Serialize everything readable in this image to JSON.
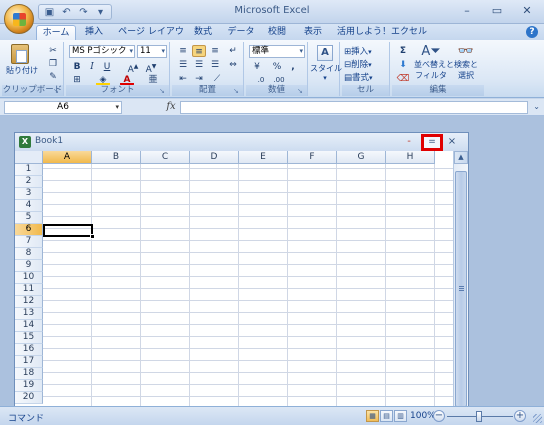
{
  "app": {
    "title": "Microsoft Excel",
    "quick_access": [
      "save-icon",
      "undo-icon",
      "redo-icon",
      "customize-icon"
    ],
    "window_controls": [
      "minimize",
      "restore",
      "close"
    ]
  },
  "ribbon": {
    "tabs": [
      {
        "label": "ホーム",
        "active": true
      },
      {
        "label": "挿入",
        "active": false
      },
      {
        "label": "ページ レイアウト",
        "active": false
      },
      {
        "label": "数式",
        "active": false
      },
      {
        "label": "データ",
        "active": false
      },
      {
        "label": "校閲",
        "active": false
      },
      {
        "label": "表示",
        "active": false
      },
      {
        "label": "活用しよう！エクセル",
        "active": false
      }
    ],
    "clipboard": {
      "group_label": "クリップボード",
      "paste_label": "貼り付け"
    },
    "font": {
      "group_label": "フォント",
      "font_name": "MS Pゴシック",
      "font_size": "11",
      "bold": "B",
      "italic": "I",
      "underline": "U"
    },
    "alignment": {
      "group_label": "配置"
    },
    "number": {
      "group_label": "数値",
      "format": "標準",
      "percent": "%",
      "comma": ","
    },
    "styles": {
      "label": "スタイル"
    },
    "cells": {
      "group_label": "セル",
      "insert": "挿入",
      "delete": "削除",
      "format": "書式"
    },
    "editing": {
      "group_label": "編集",
      "sum": "Σ",
      "sort_filter_1": "並べ替えと",
      "sort_filter_2": "フィルタ",
      "find_select_1": "検索と",
      "find_select_2": "選択"
    }
  },
  "formula_bar": {
    "name_box": "A6",
    "fx_label": "fx",
    "formula": ""
  },
  "workbook": {
    "name": "Book1",
    "columns": [
      "A",
      "B",
      "C",
      "D",
      "E",
      "F",
      "G",
      "H"
    ],
    "rows": [
      "1",
      "2",
      "3",
      "4",
      "5",
      "6",
      "7",
      "8",
      "9",
      "10",
      "11",
      "12",
      "13",
      "14",
      "15",
      "16",
      "17",
      "18",
      "19",
      "20"
    ],
    "selected_column": "A",
    "selected_row": "6",
    "active_cell": "A6",
    "highlight_color": "#e00000"
  },
  "status": {
    "mode": "コマンド",
    "zoom": "100%"
  }
}
